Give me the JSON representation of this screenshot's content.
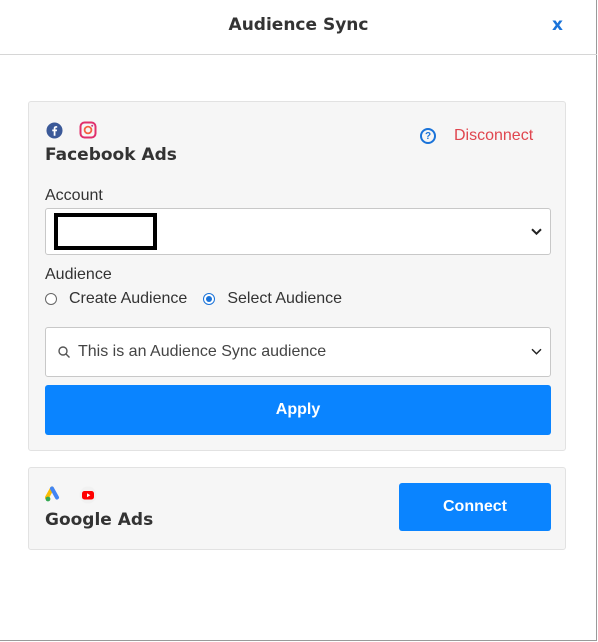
{
  "header": {
    "title": "Audience Sync",
    "close_label": "x"
  },
  "facebook": {
    "title": "Facebook Ads",
    "icons": [
      "facebook-icon",
      "instagram-icon"
    ],
    "help_icon": "question-circle-icon",
    "disconnect_label": "Disconnect",
    "account_label": "Account",
    "account_value_redacted": true,
    "audience_label": "Audience",
    "radio_options": [
      {
        "label": "Create Audience",
        "checked": false
      },
      {
        "label": "Select Audience",
        "checked": true
      }
    ],
    "audience_value": "This is an Audience Sync audience",
    "apply_label": "Apply"
  },
  "google": {
    "title": "Google Ads",
    "icons": [
      "google-ads-icon",
      "youtube-icon"
    ],
    "connect_label": "Connect"
  },
  "colors": {
    "accent": "#0a84ff",
    "link_blue": "#1a73d9",
    "danger": "#e0464f",
    "card_bg": "#f6f6f6"
  }
}
